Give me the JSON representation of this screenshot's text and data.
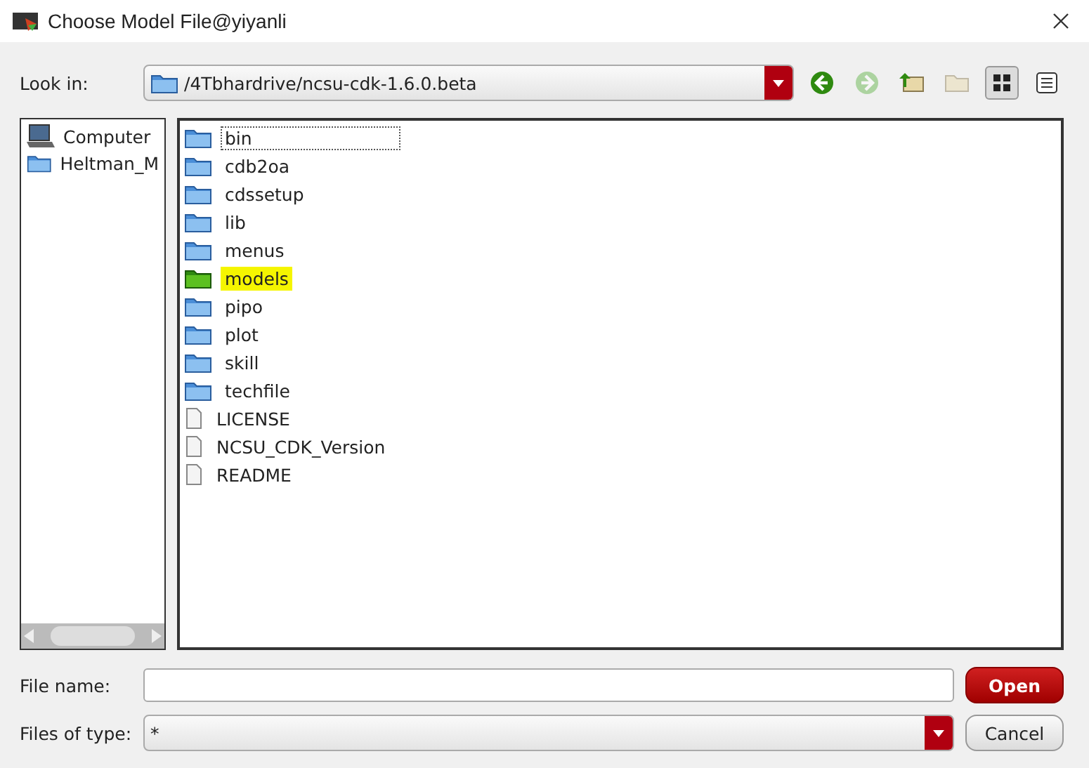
{
  "window": {
    "title": "Choose Model File@yiyanli"
  },
  "look_in": {
    "label": "Look in:",
    "path": "/4Tbhardrive/ncsu-cdk-1.6.0.beta"
  },
  "toolbar": [
    {
      "kind": "back",
      "disabled": false,
      "selected": false
    },
    {
      "kind": "forward",
      "disabled": true,
      "selected": false
    },
    {
      "kind": "parent",
      "disabled": false,
      "selected": false
    },
    {
      "kind": "new-folder",
      "disabled": true,
      "selected": false
    },
    {
      "kind": "icon-view",
      "disabled": false,
      "selected": true
    },
    {
      "kind": "list-view",
      "disabled": false,
      "selected": false
    }
  ],
  "sidebar": {
    "items": [
      {
        "kind": "computer",
        "label": "Computer"
      },
      {
        "kind": "folder",
        "label": "Heltman_M"
      }
    ]
  },
  "files": [
    {
      "kind": "folder",
      "name": "bin",
      "focused": true,
      "highlighted": false
    },
    {
      "kind": "folder",
      "name": "cdb2oa",
      "focused": false,
      "highlighted": false
    },
    {
      "kind": "folder",
      "name": "cdssetup",
      "focused": false,
      "highlighted": false
    },
    {
      "kind": "folder",
      "name": "lib",
      "focused": false,
      "highlighted": false
    },
    {
      "kind": "folder",
      "name": "menus",
      "focused": false,
      "highlighted": false
    },
    {
      "kind": "folder",
      "name": "models",
      "focused": false,
      "highlighted": true
    },
    {
      "kind": "folder",
      "name": "pipo",
      "focused": false,
      "highlighted": false
    },
    {
      "kind": "folder",
      "name": "plot",
      "focused": false,
      "highlighted": false
    },
    {
      "kind": "folder",
      "name": "skill",
      "focused": false,
      "highlighted": false
    },
    {
      "kind": "folder",
      "name": "techfile",
      "focused": false,
      "highlighted": false
    },
    {
      "kind": "file",
      "name": "LICENSE",
      "focused": false,
      "highlighted": false
    },
    {
      "kind": "file",
      "name": "NCSU_CDK_Version",
      "focused": false,
      "highlighted": false
    },
    {
      "kind": "file",
      "name": "README",
      "focused": false,
      "highlighted": false
    }
  ],
  "file_name": {
    "label": "File name:"
  },
  "file_type": {
    "label": "Files of type:",
    "value": "*"
  },
  "buttons": [
    {
      "kind": "primary",
      "label": "Open"
    },
    {
      "kind": "secondary",
      "label": "Cancel"
    }
  ]
}
